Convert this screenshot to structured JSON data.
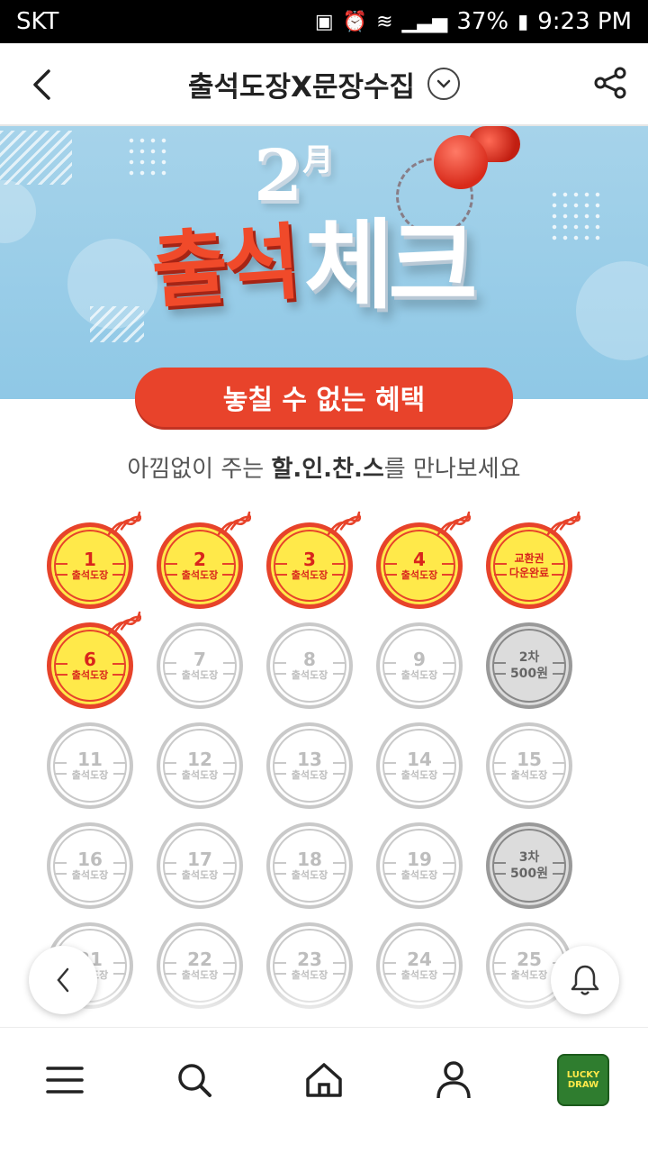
{
  "status_bar": {
    "carrier": "SKT",
    "battery": "37%",
    "time": "9:23 PM"
  },
  "header": {
    "title": "출석도장X문장수집"
  },
  "banner": {
    "month": "2",
    "month_unit": "月",
    "attend": "출석",
    "check": "체크"
  },
  "benefit_pill": "놓칠 수 없는 혜택",
  "subtitle": {
    "prefix": "아낌없이 주는 ",
    "bold": "할.인.찬.스",
    "suffix": "를 만나보세요"
  },
  "stamp_label": "출석도장",
  "stamps": [
    {
      "num": "1",
      "label": "출석도장",
      "state": "done"
    },
    {
      "num": "2",
      "label": "출석도장",
      "state": "done"
    },
    {
      "num": "3",
      "label": "출석도장",
      "state": "done"
    },
    {
      "num": "4",
      "label": "출석도장",
      "state": "done"
    },
    {
      "num": "교환권",
      "label": "다운완료",
      "state": "voucher"
    },
    {
      "num": "6",
      "label": "출석도장",
      "state": "done"
    },
    {
      "num": "7",
      "label": "출석도장",
      "state": "pending"
    },
    {
      "num": "8",
      "label": "출석도장",
      "state": "pending"
    },
    {
      "num": "9",
      "label": "출석도장",
      "state": "pending"
    },
    {
      "num": "2차",
      "label": "500원",
      "state": "reward"
    },
    {
      "num": "11",
      "label": "출석도장",
      "state": "pending"
    },
    {
      "num": "12",
      "label": "출석도장",
      "state": "pending"
    },
    {
      "num": "13",
      "label": "출석도장",
      "state": "pending"
    },
    {
      "num": "14",
      "label": "출석도장",
      "state": "pending"
    },
    {
      "num": "15",
      "label": "출석도장",
      "state": "pending"
    },
    {
      "num": "16",
      "label": "출석도장",
      "state": "pending"
    },
    {
      "num": "17",
      "label": "출석도장",
      "state": "pending"
    },
    {
      "num": "18",
      "label": "출석도장",
      "state": "pending"
    },
    {
      "num": "19",
      "label": "출석도장",
      "state": "pending"
    },
    {
      "num": "3차",
      "label": "500원",
      "state": "reward"
    },
    {
      "num": "21",
      "label": "출석도장",
      "state": "pending"
    },
    {
      "num": "22",
      "label": "출석도장",
      "state": "pending"
    },
    {
      "num": "23",
      "label": "출석도장",
      "state": "pending"
    },
    {
      "num": "24",
      "label": "출석도장",
      "state": "pending"
    },
    {
      "num": "25",
      "label": "출석도장",
      "state": "pending"
    }
  ],
  "bottom_nav": {
    "lucky_line1": "LUCKY",
    "lucky_line2": "DRAW"
  },
  "colors": {
    "accent_red": "#e8432b",
    "stamp_yellow": "#ffe94a",
    "banner_blue": "#9ccfe8"
  },
  "icons": [
    "back-arrow-icon",
    "chevron-down-icon",
    "share-icon",
    "menu-icon",
    "search-icon",
    "home-icon",
    "profile-icon",
    "bell-icon",
    "chevron-left-icon"
  ]
}
